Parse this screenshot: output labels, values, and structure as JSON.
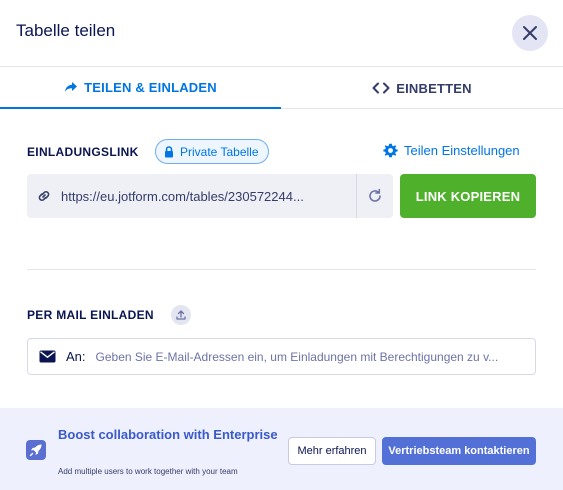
{
  "dialog": {
    "title": "Tabelle teilen",
    "close_icon": "close-icon"
  },
  "tabs": [
    {
      "label": "TEILEN & EINLADEN",
      "icon": "share-arrow-icon",
      "active": true
    },
    {
      "label": "EINBETTEN",
      "icon": "code-icon",
      "active": false
    }
  ],
  "invite": {
    "label": "EINLADUNGSLINK",
    "badge": "Private Tabelle",
    "badge_icon": "lock-icon",
    "settings_label": "Teilen Einstellungen",
    "settings_icon": "gear-icon",
    "link_url": "https://eu.jotform.com/tables/230572244...",
    "link_icon": "link-icon",
    "refresh_icon": "refresh-icon",
    "copy_label": "LINK KOPIEREN"
  },
  "mail": {
    "label": "PER MAIL EINLADEN",
    "upload_icon": "upload-icon",
    "prefix": "An:",
    "placeholder": "Geben Sie E-Mail-Adressen ein, um Einladungen mit Berechtigungen zu v...",
    "value": "",
    "mail_icon": "envelope-icon"
  },
  "promo": {
    "title": "Boost collaboration with Enterprise",
    "subtitle": "Add multiple users to work together with your team",
    "icon": "rocket-icon",
    "learn_more": "Mehr erfahren",
    "contact_sales": "Vertriebsteam kontaktieren"
  },
  "colors": {
    "accent": "#0075e3",
    "copy_button": "#4fb12b",
    "promo_bg": "#eef0fd",
    "promo_button": "#5370d6"
  }
}
